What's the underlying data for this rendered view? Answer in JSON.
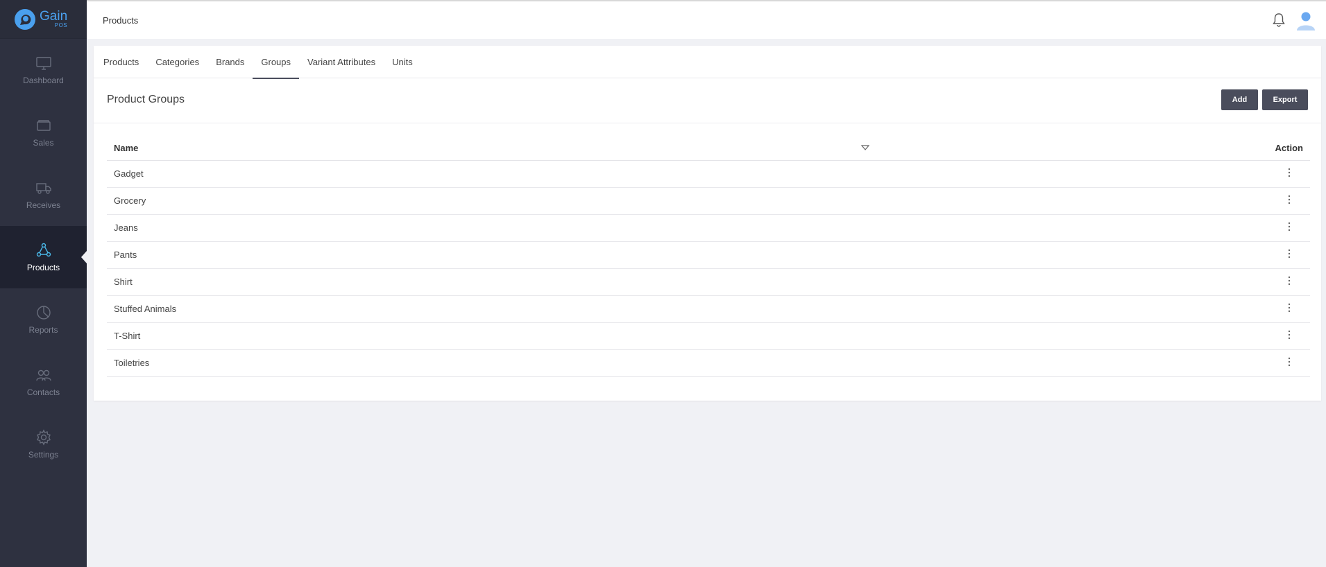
{
  "brand": {
    "name": "Gain",
    "sub": "POS"
  },
  "sidebar": {
    "items": [
      {
        "label": "Dashboard",
        "icon": "monitor-icon"
      },
      {
        "label": "Sales",
        "icon": "wallet-icon"
      },
      {
        "label": "Receives",
        "icon": "truck-icon"
      },
      {
        "label": "Products",
        "icon": "products-icon"
      },
      {
        "label": "Reports",
        "icon": "pie-chart-icon"
      },
      {
        "label": "Contacts",
        "icon": "users-icon"
      },
      {
        "label": "Settings",
        "icon": "gear-icon"
      }
    ],
    "active": "Products"
  },
  "header": {
    "title": "Products",
    "icons": [
      "bell-icon",
      "user-avatar-icon"
    ]
  },
  "tabs": [
    "Products",
    "Categories",
    "Brands",
    "Groups",
    "Variant Attributes",
    "Units"
  ],
  "active_tab": "Groups",
  "section": {
    "title": "Product Groups",
    "add_label": "Add",
    "export_label": "Export"
  },
  "table": {
    "columns": [
      "Name",
      "Action"
    ],
    "rows": [
      "Gadget",
      "Grocery",
      "Jeans",
      "Pants",
      "Shirt",
      "Stuffed Animals",
      "T-Shirt",
      "Toiletries"
    ]
  },
  "colors": {
    "accent": "#4aa0ee",
    "sidebar": "#2e3140",
    "sidebar_active": "#1f2230",
    "button": "#4a4d5c",
    "active_icon": "#4ab8e8"
  }
}
